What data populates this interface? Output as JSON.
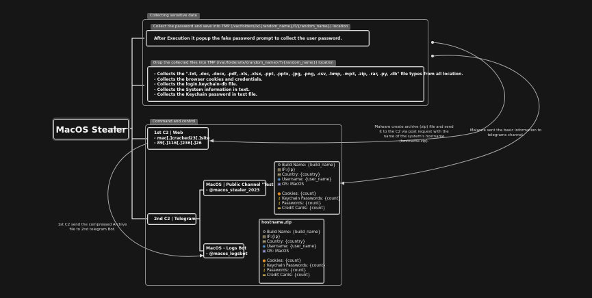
{
  "diagram": {
    "title": "MacOS Stealer",
    "collecting": {
      "label": "Collecting sensitive data",
      "password_section": {
        "label": "Collect the password and save into TMP (/var/folders/lx/{random_name}/T/{random_name}) location",
        "text": "After Execution it popup the fake password prompt to collect the user password."
      },
      "files_section": {
        "label": "Drop the collected files into TMP (/var/folders/lx/{random_name}/T/{random_name}) location",
        "items": [
          "- Collects the \".txt, .doc, .docx, .pdf, .xls, .xlsx, .ppt, .pptx, .jpg, .png, .csv, .bmp, .mp3, .zip, .rar, .py, .db\" file types from all location.",
          "- Collects the browser cookies and credentials.",
          "- Collects the login.keychain-db file.",
          "- Collects the System information in text.",
          "- Collects the Keychain password in text file."
        ]
      }
    },
    "cnc": {
      "label": "Command and control",
      "c2_web": {
        "lines": [
          "1st C2 | Web",
          "- mac[.]cracked23[.]site",
          "- 89[.]116[.]236[.]26"
        ]
      },
      "c2_telegram": {
        "label": "2nd C2 | Telegram"
      },
      "public_channel": {
        "lines": [
          "MacOS | Public Channel \"Test\"",
          "- @macos_stealer_2023"
        ]
      },
      "logs_bot": {
        "lines": [
          "MacOS - Logs Bot",
          "- @macos_logsbot"
        ]
      },
      "basic_info": {
        "lines": [
          {
            "icon": "gear-icon",
            "glyph": "⚙",
            "text": "Build Name: {build_name}"
          },
          {
            "icon": "page-icon",
            "glyph": "▤",
            "text": "IP:{ip}"
          },
          {
            "icon": "page-icon",
            "glyph": "▤",
            "text": "Country: {country}"
          },
          {
            "icon": "globe-icon",
            "glyph": "◉",
            "text": "Username: {user_name}"
          },
          {
            "icon": "computer-icon",
            "glyph": "▣",
            "text": "OS: MacOS"
          },
          {
            "icon": "",
            "glyph": "",
            "text": ""
          },
          {
            "icon": "cookie-icon",
            "glyph": "●",
            "text": "Cookies: {count}"
          },
          {
            "icon": "key-icon",
            "glyph": "⚷",
            "text": "Keychain Passwords: {count}"
          },
          {
            "icon": "key-icon",
            "glyph": "⚷",
            "text": "Passwords: {count}"
          },
          {
            "icon": "card-icon",
            "glyph": "▬",
            "text": "Credit Cards: {count}"
          }
        ]
      },
      "zip_info": {
        "header": "hostname.zip",
        "lines": [
          {
            "icon": "gear-icon",
            "glyph": "⚙",
            "text": "Build Name: {build_name}"
          },
          {
            "icon": "page-icon",
            "glyph": "▤",
            "text": "IP:{ip}"
          },
          {
            "icon": "page-icon",
            "glyph": "▤",
            "text": "Country: {country}"
          },
          {
            "icon": "globe-icon",
            "glyph": "◉",
            "text": "Username: {user_name}"
          },
          {
            "icon": "computer-icon",
            "glyph": "▣",
            "text": "OS: MacOS"
          },
          {
            "icon": "",
            "glyph": "",
            "text": ""
          },
          {
            "icon": "cookie-icon",
            "glyph": "●",
            "text": "Cookies: {count}"
          },
          {
            "icon": "key-icon",
            "glyph": "⚷",
            "text": "Keychain Passwords: {count}"
          },
          {
            "icon": "key-icon",
            "glyph": "⚷",
            "text": "Passwords: {count}"
          },
          {
            "icon": "card-icon",
            "glyph": "▬",
            "text": "Credit Cards: {count}"
          }
        ]
      }
    },
    "notes": {
      "archive_note": "Malware create archive (zip) file and send it to the C2 via post request with the name of the system's hostname (hostname.zip).",
      "basic_note": "Malware sent the basic information to telegrams channel.",
      "telegram_note": "1st C2 send the compressed Archive file to 2nd telegram Bot."
    }
  }
}
